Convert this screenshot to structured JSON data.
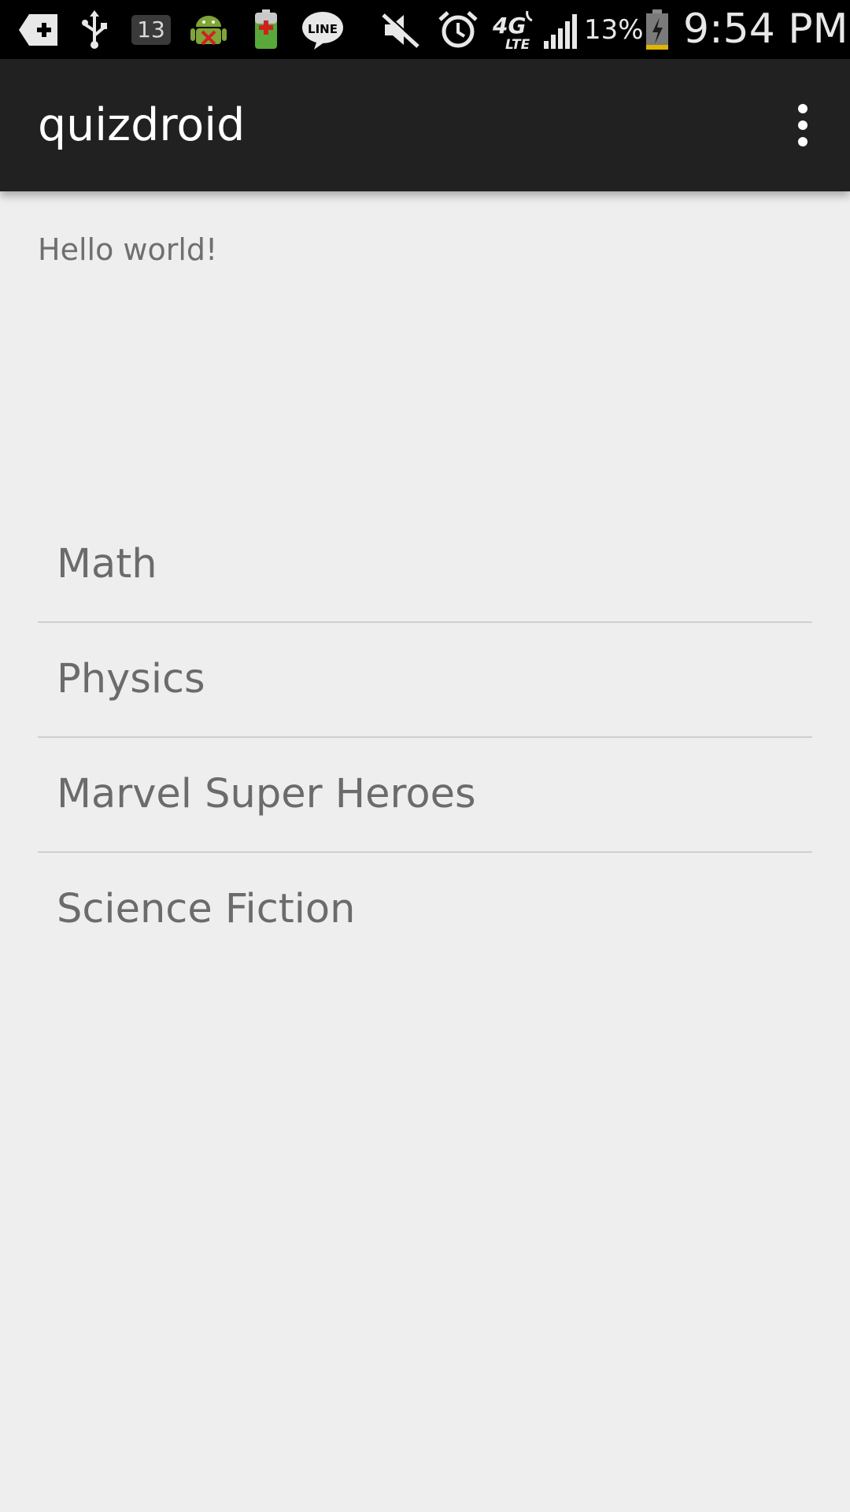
{
  "status_bar": {
    "notification_count": "13",
    "line_label": "LINE",
    "network_label": "4G",
    "network_sub": "LTE",
    "battery_percent": "13%",
    "time": "9:54 PM",
    "icons": [
      "add-icon",
      "usb-icon",
      "notification-count-icon",
      "android-debug-icon",
      "battery-app-icon",
      "line-app-icon",
      "mute-icon",
      "alarm-icon",
      "lte-icon",
      "signal-icon",
      "battery-icon"
    ]
  },
  "app_bar": {
    "title": "quizdroid",
    "menu_icon": "overflow-menu-icon"
  },
  "main": {
    "hello_text": "Hello world!",
    "topics": [
      {
        "label": "Math"
      },
      {
        "label": "Physics"
      },
      {
        "label": "Marvel Super Heroes"
      },
      {
        "label": "Science Fiction"
      }
    ]
  },
  "colors": {
    "app_bar": "#212121",
    "status_bar": "#000000",
    "background": "#eeeeee",
    "item_text": "#6b6b6b",
    "divider": "#cfcfcf"
  }
}
